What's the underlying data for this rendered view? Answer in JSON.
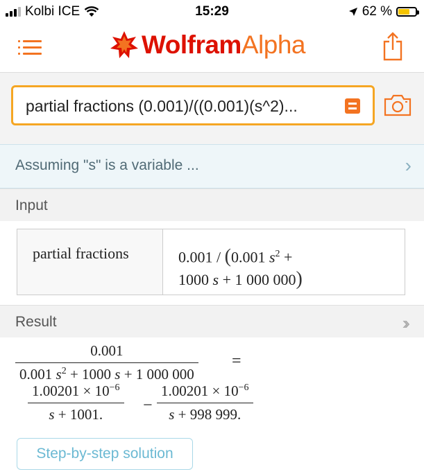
{
  "status_bar": {
    "carrier": "Kolbi ICE",
    "time": "15:29",
    "battery": "62 %",
    "battery_level": 0.62
  },
  "header": {
    "logo_wolfram": "Wolfram",
    "logo_alpha": "Alpha"
  },
  "search": {
    "query": "partial fractions (0.001)/((0.001)(s^2)..."
  },
  "assumption": {
    "text": "Assuming \"s\" is a variable ..."
  },
  "input_pod": {
    "title": "Input",
    "label": "partial fractions",
    "expr_line1_a": "0.001 / ",
    "expr_line1_b": "(",
    "expr_line1_c": "0.001 ",
    "expr_var": "s",
    "expr_exp": "2",
    "expr_line1_d": " +",
    "expr_line2_a": "1000 ",
    "expr_line2_var": "s",
    "expr_line2_b": " + 1 000 000",
    "expr_line2_c": ")"
  },
  "result_pod": {
    "title": "Result",
    "lhs_num": "0.001",
    "lhs_den_a": "0.001 ",
    "lhs_den_var": "s",
    "lhs_den_exp": "2",
    "lhs_den_b": " + 1000 ",
    "lhs_den_var2": "s",
    "lhs_den_c": " + 1 000 000",
    "equals": "=",
    "t1_num": "1.00201 × 10",
    "t1_exp": "−6",
    "t1_den_var": "s",
    "t1_den": " + 1001.",
    "minus": "−",
    "t2_num": "1.00201 × 10",
    "t2_exp": "−6",
    "t2_den_var": "s",
    "t2_den": " + 998 999."
  },
  "buttons": {
    "step_by_step": "Step-by-step solution"
  },
  "colors": {
    "brand_red": "#dd1100",
    "brand_orange": "#f37321",
    "search_border": "#f5a623",
    "link_blue": "#6bb9d3"
  }
}
